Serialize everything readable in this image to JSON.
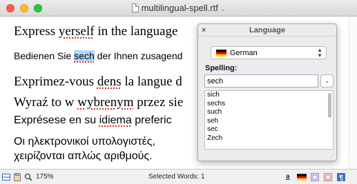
{
  "window": {
    "title": "multilingual-spell.rtf",
    "title_menu_icon": "chevron-down-icon"
  },
  "document": {
    "lines": [
      {
        "before": "Express ",
        "misspelled": "yerself",
        "after": " in the language"
      },
      {
        "before": "Bedienen Sie ",
        "selected": "sech",
        "after": " der Ihnen zusagend"
      },
      {
        "before": "Exprimez-vous ",
        "misspelled": "dens",
        "after": " la langue d"
      },
      {
        "before": "Wyraź to w ",
        "misspelled": "wybrenym",
        "after": " przez sie"
      },
      {
        "before": "Exprésese en su ",
        "misspelled": "idiema",
        "after": " preferic"
      },
      {
        "line1": "Οι ηλεκτρονικοί υπολογιστές, ",
        "line2": "χειρίζονται απλώς αριθμούς."
      }
    ]
  },
  "statusbar": {
    "zoom": "175%",
    "selected": "Selected Words: 1",
    "underline_char": "a"
  },
  "language_panel": {
    "title": "Language",
    "close_glyph": "×",
    "language": "German",
    "spelling_label": "Spelling:",
    "spelling_value": "sech",
    "suggestions": [
      "sich",
      "sechs",
      "such",
      "seh",
      "sec",
      "Zech"
    ]
  },
  "colors": {
    "misspell_underline": "#e0262b",
    "selection": "#b3d7ff"
  }
}
